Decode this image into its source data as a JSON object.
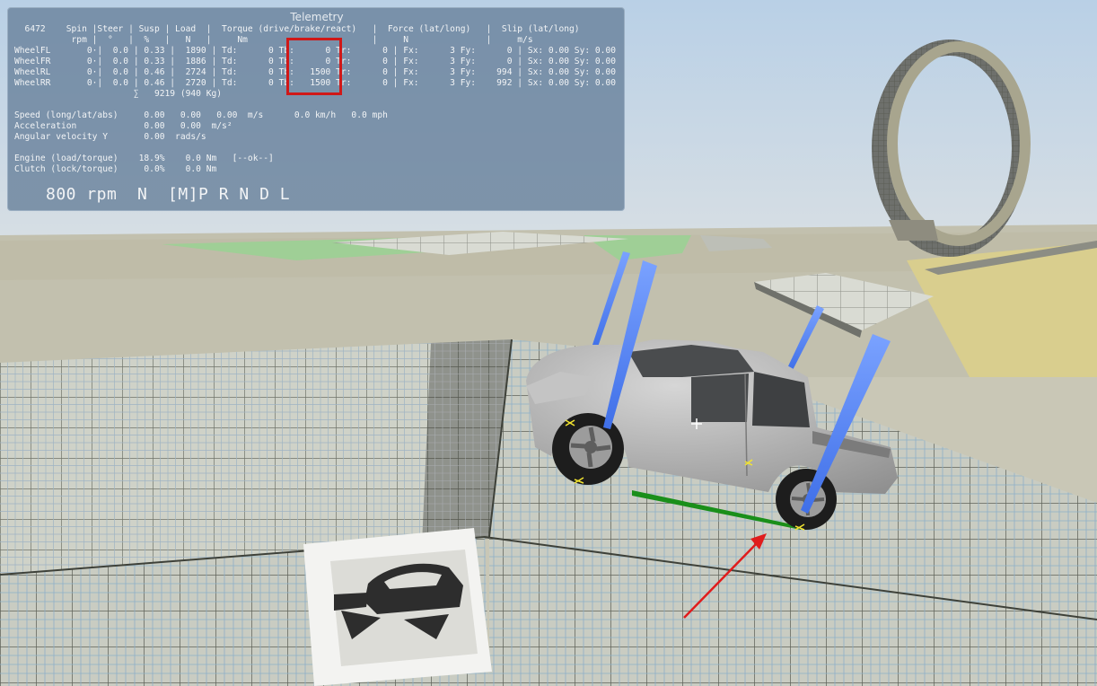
{
  "telemetry": {
    "title": "Telemetry",
    "wheel_header_1": "  6472    Spin |Steer | Susp | Load  |  Torque (drive/brake/react)   |  Force (lat/long)   |  Slip (lat/long)",
    "wheel_header_2": "           rpm |  °   |  %   |   N   |     Nm                        |     N               |     m/s",
    "wheel_rows": [
      "WheelFL       0·|  0.0 | 0.33 |  1890 | Td:      0 Tb:      0 Tr:      0 | Fx:      3 Fy:      0 | Sx: 0.00 Sy: 0.00",
      "WheelFR       0·|  0.0 | 0.33 |  1886 | Td:      0 Tb:      0 Tr:      0 | Fx:      3 Fy:      0 | Sx: 0.00 Sy: 0.00",
      "WheelRL       0·|  0.0 | 0.46 |  2724 | Td:      0 Tb:   1500 Tr:      0 | Fx:      3 Fy:    994 | Sx: 0.00 Sy: 0.00",
      "WheelRR       0·|  0.0 | 0.46 |  2720 | Td:      0 Tb:   1500 Tr:      0 | Fx:      3 Fy:    992 | Sx: 0.00 Sy: 0.00"
    ],
    "load_total": "                       ∑   9219 (940 Kg)",
    "speed_line": "Speed (long/lat/abs)     0.00   0.00   0.00  m/s      0.0 km/h   0.0 mph",
    "accel_line": "Acceleration             0.00   0.00  m/s²",
    "angvel_line": "Angular velocity Y       0.00  rads/s",
    "engine_line": "Engine (load/torque)    18.9%    0.0 Nm   [--ok--]",
    "clutch_line": "Clutch (lock/torque)     0.0%    0.0 Nm",
    "gear_line": "800 rpm  N  [M]P R N D L"
  }
}
